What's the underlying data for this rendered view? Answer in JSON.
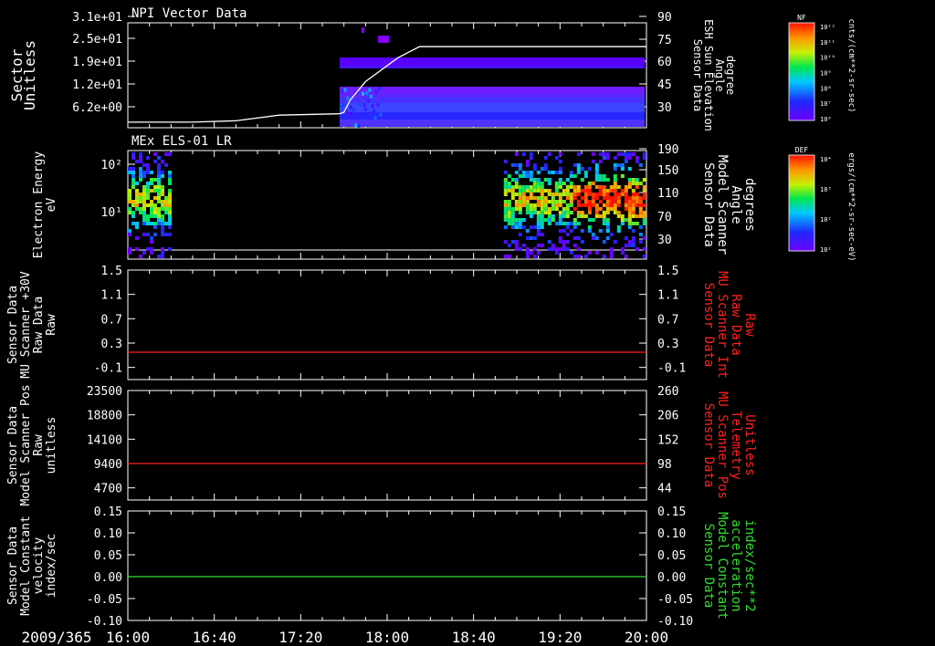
{
  "colors": {
    "white": "#ffffff",
    "red": "#ff2020",
    "green": "#33dd33",
    "bg": "#000000"
  },
  "colorbars": [
    {
      "label": "NF",
      "unit": "cnts/(cm**2-sr-sec)",
      "ticks": [
        "10¹²",
        "10¹¹",
        "10¹⁰",
        "10⁹",
        "10⁸",
        "10⁷",
        "10⁶"
      ]
    },
    {
      "label": "DEF",
      "unit": "ergs/(cm**2-sr-sec-eV)",
      "ticks": [
        "10⁴",
        "10³",
        "10²",
        "10¹"
      ]
    }
  ],
  "chart_data": [
    {
      "type": "heatmap",
      "title": "NPI Vector Data",
      "ylabel": [
        "Sector",
        "Unitless"
      ],
      "yticks": [
        "3.1e+01",
        "2.5e+01",
        "1.9e+01",
        "1.2e+01",
        "6.2e+00"
      ],
      "y2label": [
        "Sensor Data",
        "ESH Sun Elevation",
        "Angle",
        "degree"
      ],
      "y2ticks": [
        "90",
        "75",
        "60",
        "45",
        "30"
      ],
      "y2lim": [
        15,
        90
      ],
      "line": {
        "x": [
          0,
          30,
          50,
          70,
          98,
          100,
          103,
          110,
          125,
          135,
          140,
          240
        ],
        "y": [
          19,
          19,
          20,
          24,
          25,
          26,
          35,
          48,
          65,
          73,
          73,
          73
        ]
      },
      "data_start": 98
    },
    {
      "type": "heatmap",
      "title": "MEx ELS-01 LR",
      "ylabel": [
        "Electron Energy",
        "eV"
      ],
      "yticks": [
        "10²",
        "10¹"
      ],
      "y2label": [
        "Sensor Data",
        "Model Scanner",
        "Angle",
        "degrees"
      ],
      "y2ticks": [
        "190",
        "150",
        "110",
        "70",
        "30"
      ],
      "segments": [
        [
          0,
          20
        ],
        [
          174,
          240
        ]
      ],
      "hot_segment": [
        206,
        240
      ]
    },
    {
      "type": "line",
      "ylabel": [
        "Sensor Data",
        "MU Scanner +30V",
        "Raw Data",
        "Raw"
      ],
      "yticks": [
        "1.5",
        "1.1",
        "0.7",
        "0.3",
        "-0.1"
      ],
      "ylim": [
        -0.3,
        1.5
      ],
      "y2label": [
        "Sensor Data",
        "MU Scanner Int",
        "Raw Data",
        "Raw"
      ],
      "y2ticks": [
        "1.5",
        "1.1",
        "0.7",
        "0.3",
        "-0.1"
      ],
      "series": [
        {
          "color": "red",
          "values": [
            0
          ]
        }
      ]
    },
    {
      "type": "line",
      "ylabel": [
        "Sensor Data",
        "Model Scanner Pos",
        "Raw",
        "unitless"
      ],
      "yticks": [
        "23500",
        "18800",
        "14100",
        "9400",
        "4700"
      ],
      "ylim": [
        0,
        23500
      ],
      "y2label": [
        "Sensor Data",
        "MU Scanner Pos",
        "Telemetry",
        "Unitless"
      ],
      "y2ticks": [
        "260",
        "206",
        "152",
        "98",
        "44"
      ],
      "series": [
        {
          "color": "red",
          "values": [
            7600
          ]
        }
      ]
    },
    {
      "type": "line",
      "ylabel": [
        "Sensor Data",
        "Model Constant",
        "velocity",
        "index/sec"
      ],
      "yticks": [
        "0.15",
        "0.10",
        "0.05",
        "0.00",
        "-0.05",
        "-0.10"
      ],
      "ylim": [
        -0.1,
        0.15
      ],
      "y2label": [
        "Sensor Data",
        "Model Constant",
        "acceleration",
        "index/sec**2"
      ],
      "y2ticks": [
        "0.15",
        "0.10",
        "0.05",
        "0.00",
        "-0.05",
        "-0.10"
      ],
      "series": [
        {
          "color": "green",
          "values": [
            0.0
          ]
        }
      ]
    }
  ],
  "xaxis": {
    "date": "2009/365",
    "ticks": [
      "16:00",
      "16:40",
      "17:20",
      "18:00",
      "18:40",
      "19:20",
      "20:00"
    ],
    "xlim": [
      0,
      240
    ]
  }
}
